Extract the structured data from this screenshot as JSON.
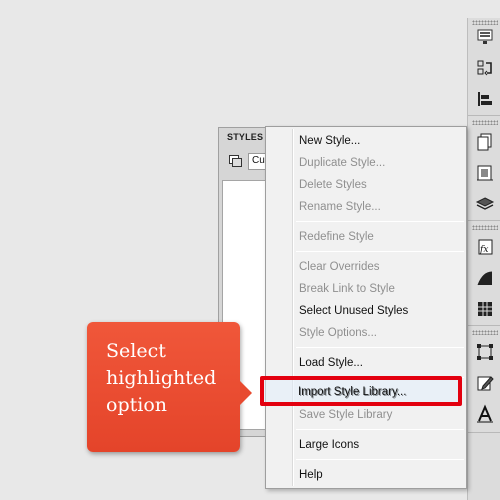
{
  "toolbar": {
    "icons": [
      "display-icon",
      "transform-icon",
      "align-icon",
      "pages-icon",
      "links-icon",
      "layers-icon",
      "effects-icon",
      "gradient-icon",
      "swatches-icon",
      "transform-box-icon",
      "edit-icon",
      "character-icon"
    ]
  },
  "panel": {
    "title": "STYLES",
    "dropdown_value": "Cur"
  },
  "menu": {
    "items": [
      {
        "label": "New Style...",
        "enabled": true
      },
      {
        "label": "Duplicate Style...",
        "enabled": false
      },
      {
        "label": "Delete Styles",
        "enabled": false
      },
      {
        "label": "Rename Style...",
        "enabled": false
      },
      {
        "label": "Redefine Style",
        "enabled": false
      },
      {
        "label": "Clear Overrides",
        "enabled": false
      },
      {
        "label": "Break Link to Style",
        "enabled": false
      },
      {
        "label": "Select Unused Styles",
        "enabled": true
      },
      {
        "label": "Style Options...",
        "enabled": false
      },
      {
        "label": "Load Style...",
        "enabled": true
      },
      {
        "label": "Import Style Library...",
        "enabled": true,
        "highlighted": true
      },
      {
        "label": "Save Style Library",
        "enabled": false
      },
      {
        "label": "Large Icons",
        "enabled": true
      },
      {
        "label": "Help",
        "enabled": true
      }
    ]
  },
  "callout": {
    "text": "Select highlighted option",
    "color": "#e84a2f"
  },
  "highlight_color": "#e3000f"
}
